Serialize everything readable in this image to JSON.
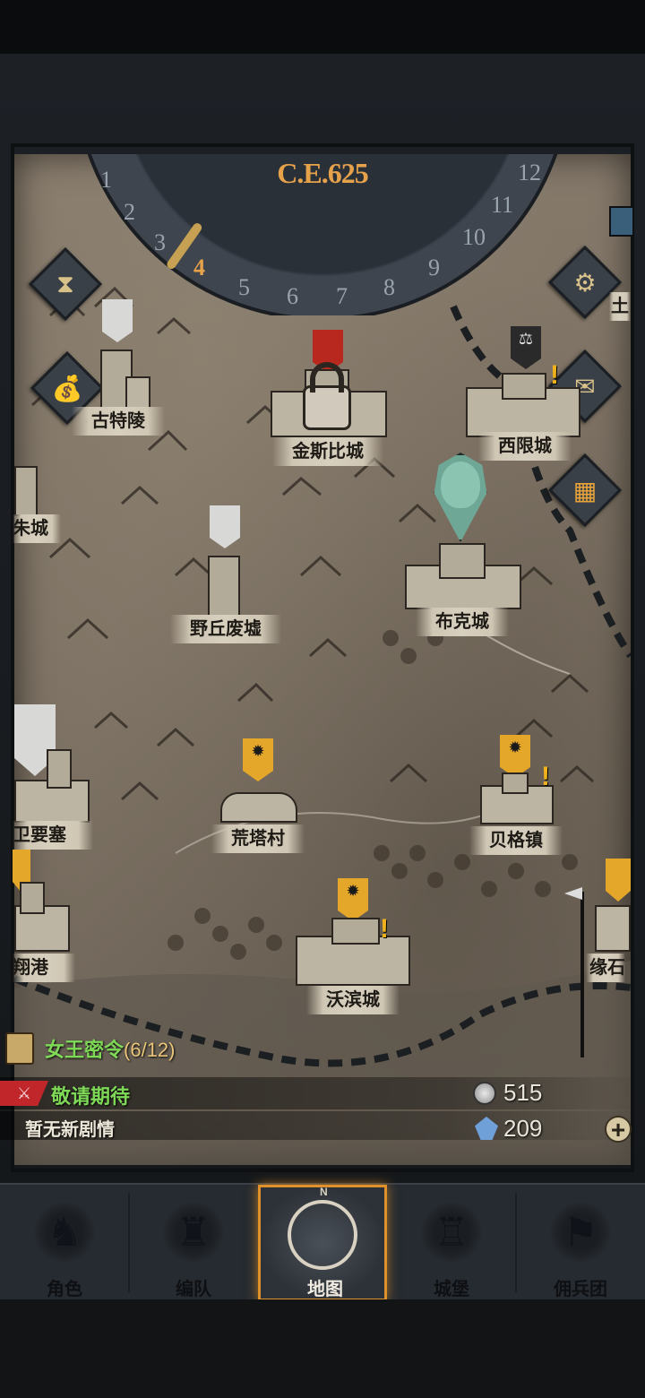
{
  "calendar": {
    "year": "C.E.625",
    "months": [
      "1",
      "2",
      "3",
      "4",
      "5",
      "6",
      "7",
      "8",
      "9",
      "10",
      "11",
      "12"
    ],
    "current_month": "4"
  },
  "locations": {
    "gutling": "古特陵",
    "jinsibi": "金斯比城",
    "xixian": "西限城",
    "zhu": "朱城",
    "yeqiu": "野丘废墟",
    "buke": "布克城",
    "weiyao": "卫要塞",
    "huangta": "荒塔村",
    "beige": "贝格镇",
    "xiang": "翔港",
    "wobin": "沃滨城",
    "yuanshi": "缘石",
    "tu": "土"
  },
  "quest": {
    "title": "女王密令",
    "progress": "(6/12)"
  },
  "event": {
    "label": "敬请期待",
    "story": "暂无新剧情"
  },
  "resources": {
    "silver": "515",
    "crystal": "209"
  },
  "nav": {
    "character": "角色",
    "formation": "编队",
    "map": "地图",
    "castle": "城堡",
    "mercenary": "佣兵团",
    "compass_n": "N"
  },
  "icons": {
    "add": "+",
    "sword": "⚔"
  }
}
